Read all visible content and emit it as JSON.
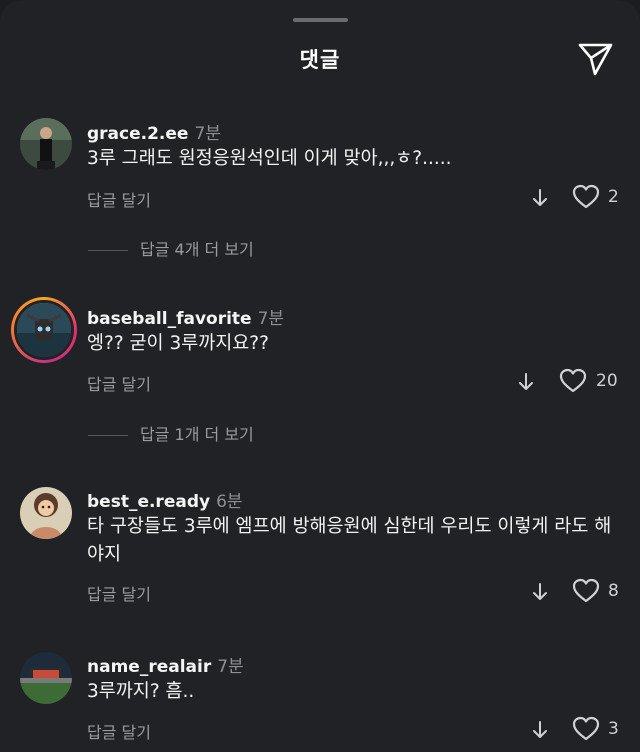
{
  "header": {
    "title": "댓글",
    "share_icon": "send-paper-plane-icon"
  },
  "reply_label": "답글 달기",
  "comments": [
    {
      "username": "grace.2.ee",
      "time": "7분",
      "text": "3루 그래도 원정응원석인데 이게 맞아,,,ㅎ?.....",
      "likes": "2",
      "view_replies": "답글 4개 더 보기"
    },
    {
      "username": "baseball_favorite",
      "time": "7분",
      "text": "엥?? 굳이 3루까지요??",
      "likes": "20",
      "view_replies": "답글 1개 더 보기"
    },
    {
      "username": "best_e.ready",
      "time": "6분",
      "text": "타 구장들도 3루에 엠프에 방해응원에 심한데 우리도 이렇게 라도 해야지",
      "likes": "8"
    },
    {
      "username": "name_realair",
      "time": "7분",
      "text": "3루까지? 흠..",
      "likes": "3"
    }
  ],
  "colors": {
    "background": "#212225",
    "text": "#f3f3f3",
    "muted": "#9a9b9f",
    "story_ring": "#e1306c"
  }
}
